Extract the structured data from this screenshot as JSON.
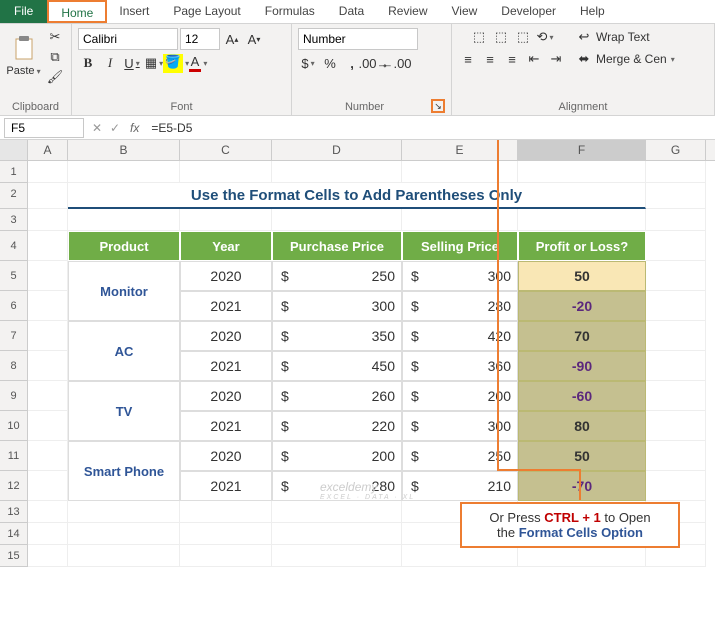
{
  "tabs": {
    "file": "File",
    "home": "Home",
    "insert": "Insert",
    "page_layout": "Page Layout",
    "formulas": "Formulas",
    "data": "Data",
    "review": "Review",
    "view": "View",
    "developer": "Developer",
    "help": "Help"
  },
  "ribbon": {
    "clipboard": {
      "paste": "Paste",
      "label": "Clipboard"
    },
    "font": {
      "name": "Calibri",
      "size": "12",
      "label": "Font"
    },
    "number": {
      "format": "Number",
      "label": "Number"
    },
    "alignment": {
      "wrap": "Wrap Text",
      "merge": "Merge & Cen",
      "label": "Alignment"
    }
  },
  "formula_bar": {
    "name": "F5",
    "formula": "=E5-D5"
  },
  "columns": {
    "A": "A",
    "B": "B",
    "C": "C",
    "D": "D",
    "E": "E",
    "F": "F",
    "G": "G"
  },
  "title": "Use the Format Cells to Add Parentheses Only",
  "headers": {
    "product": "Product",
    "year": "Year",
    "purchase": "Purchase Price",
    "selling": "Selling Price",
    "profit": "Profit or Loss?"
  },
  "rows": [
    {
      "n": "5",
      "product": "Monitor",
      "year": "2020",
      "pp": "250",
      "sp": "300",
      "pl": "50",
      "neg": false,
      "prodspan": true
    },
    {
      "n": "6",
      "product": "",
      "year": "2021",
      "pp": "300",
      "sp": "280",
      "pl": "-20",
      "neg": true,
      "prodspan": false
    },
    {
      "n": "7",
      "product": "AC",
      "year": "2020",
      "pp": "350",
      "sp": "420",
      "pl": "70",
      "neg": false,
      "prodspan": true
    },
    {
      "n": "8",
      "product": "",
      "year": "2021",
      "pp": "450",
      "sp": "360",
      "pl": "-90",
      "neg": true,
      "prodspan": false
    },
    {
      "n": "9",
      "product": "TV",
      "year": "2020",
      "pp": "260",
      "sp": "200",
      "pl": "-60",
      "neg": true,
      "prodspan": true
    },
    {
      "n": "10",
      "product": "",
      "year": "2021",
      "pp": "220",
      "sp": "300",
      "pl": "80",
      "neg": false,
      "prodspan": false
    },
    {
      "n": "11",
      "product": "Smart Phone",
      "year": "2020",
      "pp": "200",
      "sp": "250",
      "pl": "50",
      "neg": false,
      "prodspan": true
    },
    {
      "n": "12",
      "product": "",
      "year": "2021",
      "pp": "280",
      "sp": "210",
      "pl": "-70",
      "neg": true,
      "prodspan": false
    }
  ],
  "callout": {
    "line1_a": "Or Press ",
    "line1_b": "CTRL + 1",
    "line1_c": " to Open",
    "line2_a": "the ",
    "line2_b": "Format Cells Option"
  },
  "watermark": {
    "brand": "exceldemy",
    "tag": "EXCEL · DATA · XL"
  },
  "dollar": "$",
  "rownums_empty": [
    "1",
    "2",
    "3",
    "13",
    "14",
    "15"
  ]
}
